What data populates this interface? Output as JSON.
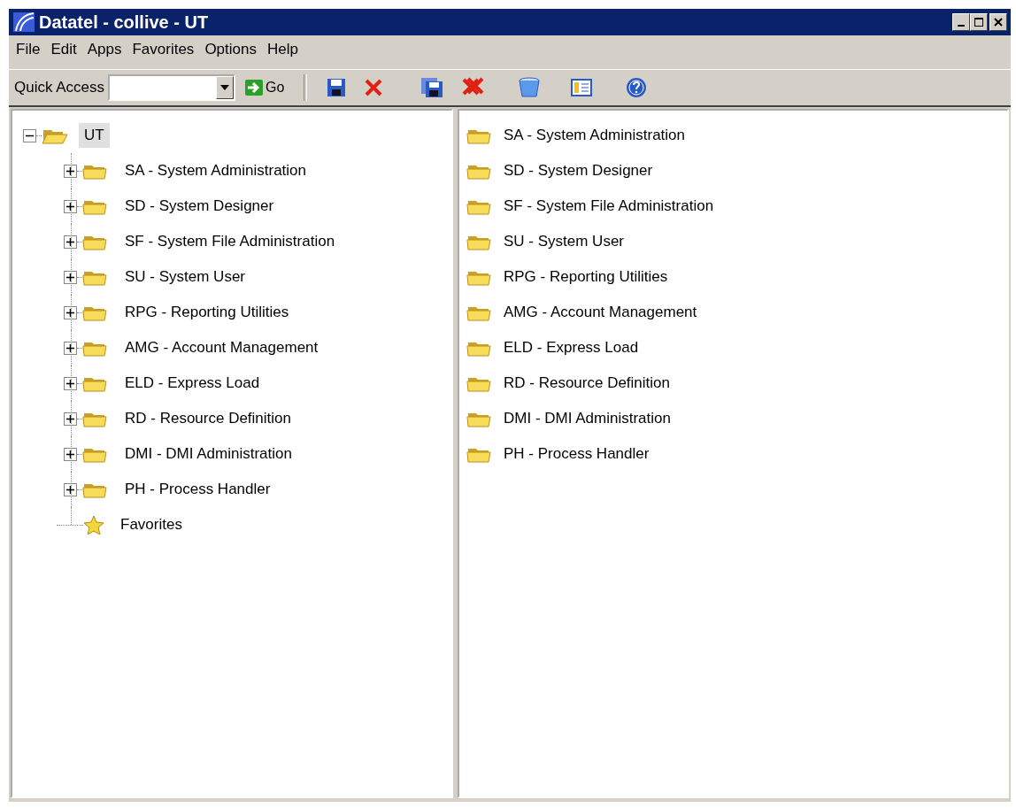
{
  "window": {
    "title": "Datatel - collive - UT"
  },
  "menu": [
    "File",
    "Edit",
    "Apps",
    "Favorites",
    "Options",
    "Help"
  ],
  "toolbar": {
    "quick_access_label": "Quick Access",
    "go_button": "Go"
  },
  "tree": {
    "label": "UT",
    "expanded": true,
    "selected": true,
    "children": [
      {
        "kind": "folder",
        "label": "SA - System Administration",
        "expanded": false
      },
      {
        "kind": "folder",
        "label": "SD - System Designer",
        "expanded": false
      },
      {
        "kind": "folder",
        "label": "SF - System File Administration",
        "expanded": false
      },
      {
        "kind": "folder",
        "label": "SU - System User",
        "expanded": false
      },
      {
        "kind": "folder",
        "label": "RPG - Reporting Utilities",
        "expanded": false
      },
      {
        "kind": "folder",
        "label": "AMG - Account Management",
        "expanded": false
      },
      {
        "kind": "folder",
        "label": "ELD - Express Load",
        "expanded": false
      },
      {
        "kind": "folder",
        "label": "RD - Resource Definition",
        "expanded": false
      },
      {
        "kind": "folder",
        "label": "DMI - DMI Administration",
        "expanded": false
      },
      {
        "kind": "folder",
        "label": "PH - Process Handler",
        "expanded": false
      },
      {
        "kind": "favorites",
        "label": "Favorites"
      }
    ]
  },
  "list": [
    "SA - System Administration",
    "SD - System Designer",
    "SF - System File Administration",
    "SU - System User",
    "RPG - Reporting Utilities",
    "AMG - Account Management",
    "ELD - Express Load",
    "RD - Resource Definition",
    "DMI - DMI Administration",
    "PH - Process Handler"
  ]
}
